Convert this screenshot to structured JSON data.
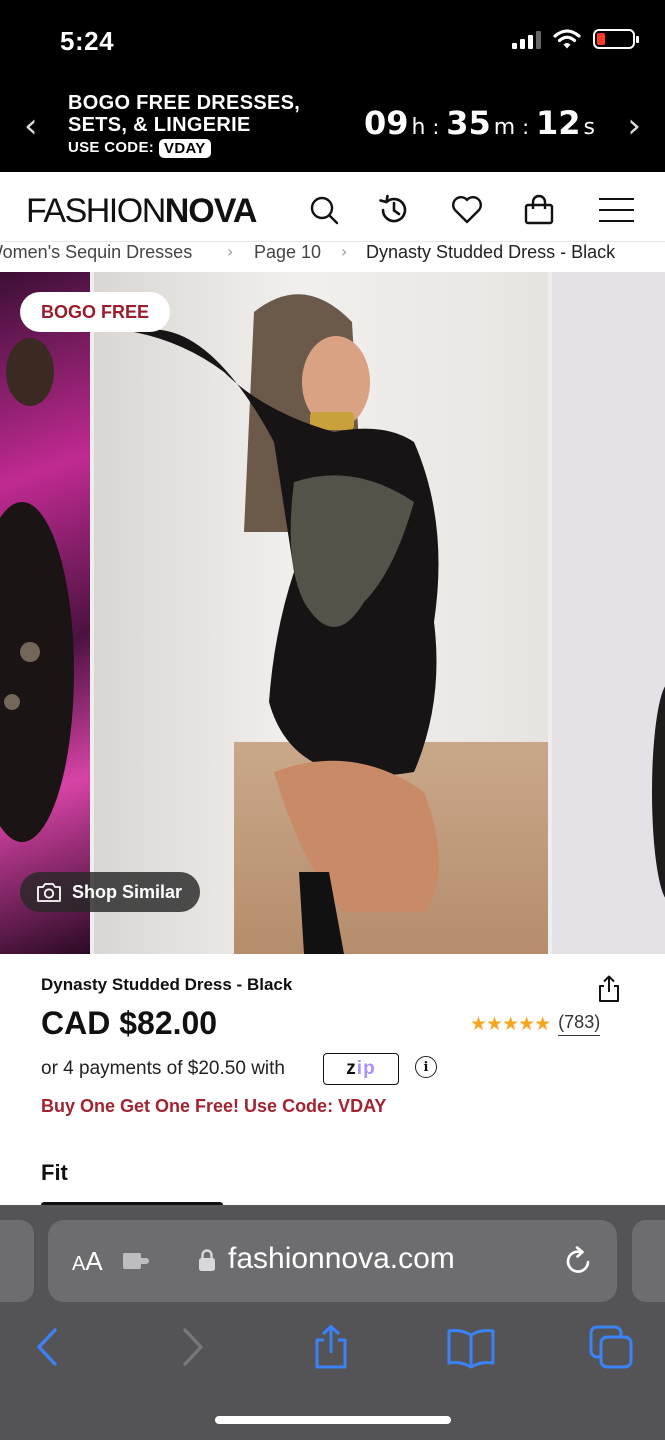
{
  "status_bar": {
    "time": "5:24"
  },
  "promo_banner": {
    "line1": "BOGO FREE DRESSES,",
    "line2": "SETS, & LINGERIE",
    "code_label": "USE CODE:",
    "code": "VDAY",
    "timer": {
      "hours": "09",
      "h": "h",
      "minutes": "35",
      "m": "m",
      "seconds": "12",
      "s": "s",
      "sep": ":"
    }
  },
  "header": {
    "logo_light": "FASHION",
    "logo_bold": "NOVA"
  },
  "breadcrumb": {
    "items": [
      "Women's Sequin Dresses",
      "Page 10",
      "Dynasty Studded Dress - Black"
    ],
    "separator": "›"
  },
  "gallery": {
    "badge": "BOGO FREE",
    "shop_similar": "Shop Similar"
  },
  "product": {
    "name": "Dynasty Studded Dress - Black",
    "price": "CAD $82.00",
    "stars": "★★★★★",
    "rating": 4.5,
    "review_count": "(783)",
    "installments": "or 4 payments of $20.50 with",
    "zip_logo_z": "z",
    "zip_logo_ip": "ip",
    "info": "i",
    "promo": "Buy One Get One Free! Use Code: VDAY",
    "fit_label": "Fit"
  },
  "safari": {
    "aa_small": "A",
    "aa_large": "A",
    "url": "fashionnova.com"
  },
  "colors": {
    "accent_red": "#a32330",
    "star": "#f5a623",
    "ios_blue": "#3a82f7"
  }
}
